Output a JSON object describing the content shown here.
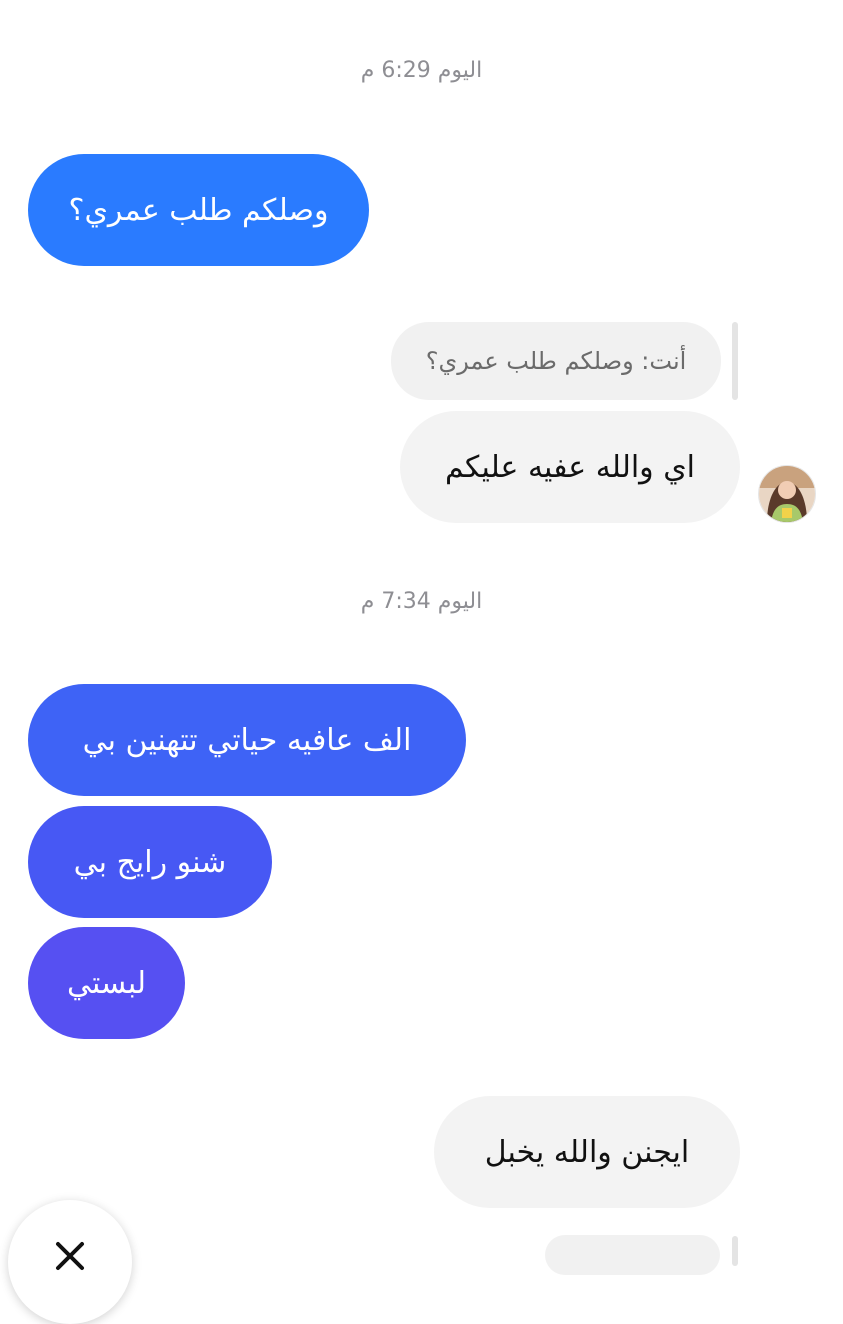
{
  "timestamps": [
    {
      "text": "اليوم 6:29 م"
    },
    {
      "text": "اليوم 7:34 م"
    }
  ],
  "messages": [
    {
      "id": "m1",
      "text": "وصلكم طلب عمري؟",
      "direction": "sent",
      "color": "#2a7bff"
    },
    {
      "id": "m2",
      "reply_to": "أنت: وصلكم طلب عمري؟",
      "text": "اي والله عفيه عليكم",
      "direction": "received"
    },
    {
      "id": "m3",
      "text": "الف عافيه حياتي تتهنين بي",
      "direction": "sent",
      "color": "#3e63f6"
    },
    {
      "id": "m4",
      "text": "شنو رايج بي",
      "direction": "sent",
      "color": "#4758f4"
    },
    {
      "id": "m5",
      "text": "لبستي",
      "direction": "sent",
      "color": "#5650f2"
    },
    {
      "id": "m6",
      "text": "ايجنن والله يخبل",
      "direction": "received"
    }
  ],
  "icons": {
    "avatar": "contact-avatar",
    "close": "close-icon"
  }
}
